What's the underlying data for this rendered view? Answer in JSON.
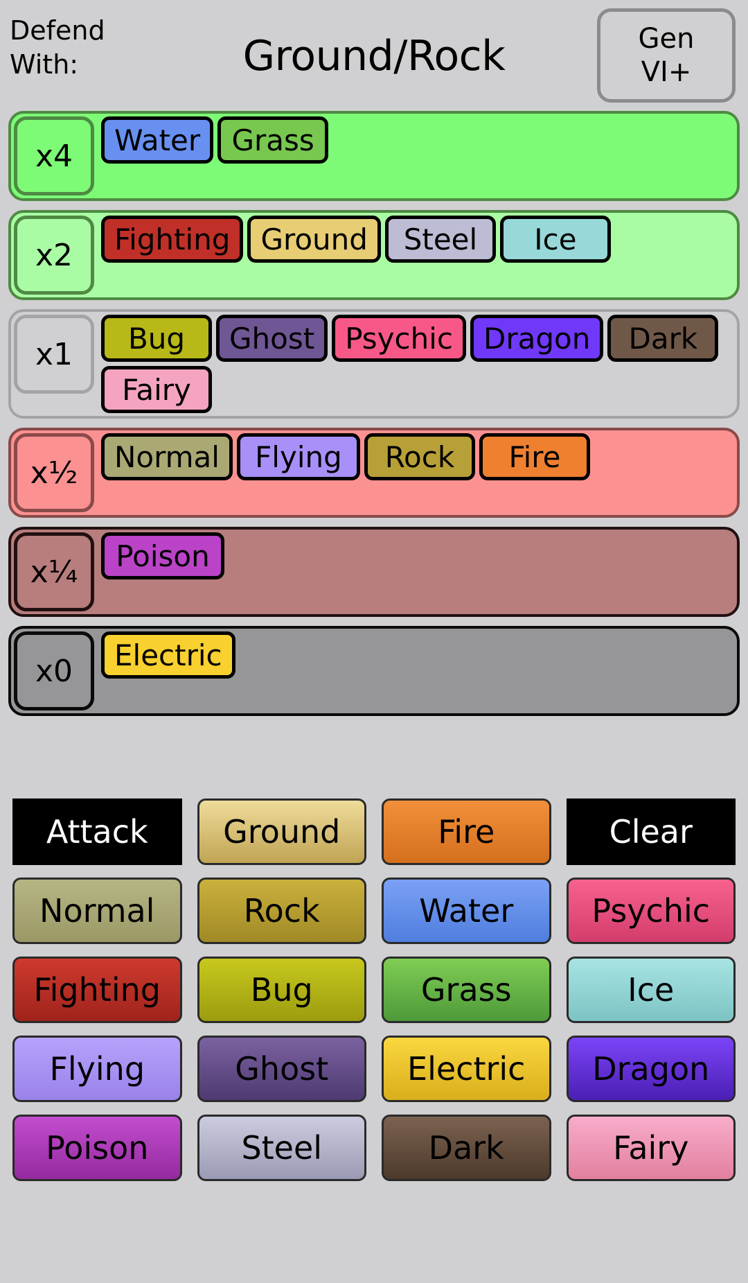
{
  "header": {
    "defend_line1": "Defend",
    "defend_line2": "With:",
    "title": "Ground/Rock",
    "gen_line1": "Gen",
    "gen_line2": "VI+"
  },
  "effectiveness": {
    "rows": [
      {
        "multiplier": "x4",
        "row_bg": "#7dfb76",
        "row_border": "#4e8a43",
        "label_bg": "#7dfb76",
        "label_border": "#4e8a43",
        "types": [
          {
            "name": "Water",
            "color": "#6890f0"
          },
          {
            "name": "Grass",
            "color": "#78c850"
          }
        ]
      },
      {
        "multiplier": "x2",
        "row_bg": "#aafca4",
        "row_border": "#4e8a43",
        "label_bg": "#aafca4",
        "label_border": "#4e8a43",
        "types": [
          {
            "name": "Fighting",
            "color": "#c03028"
          },
          {
            "name": "Ground",
            "color": "#e7cd74"
          },
          {
            "name": "Steel",
            "color": "#bcbcd4"
          },
          {
            "name": "Ice",
            "color": "#98d8d8"
          }
        ]
      },
      {
        "multiplier": "x1",
        "row_bg": "#d0d0d2",
        "row_border": "#a4a4a6",
        "label_bg": "#d0d0d2",
        "label_border": "#a4a4a6",
        "types": [
          {
            "name": "Bug",
            "color": "#b8b818"
          },
          {
            "name": "Ghost",
            "color": "#6f5694"
          },
          {
            "name": "Psychic",
            "color": "#f85888"
          },
          {
            "name": "Dragon",
            "color": "#7038f8"
          },
          {
            "name": "Dark",
            "color": "#705848"
          },
          {
            "name": "Fairy",
            "color": "#f4a4c0"
          }
        ]
      },
      {
        "multiplier": "x½",
        "row_bg": "#fb9191",
        "row_border": "#8a4a4a",
        "label_bg": "#fb9191",
        "label_border": "#8a4a4a",
        "types": [
          {
            "name": "Normal",
            "color": "#aaa974"
          },
          {
            "name": "Flying",
            "color": "#a890f8"
          },
          {
            "name": "Rock",
            "color": "#b8a038"
          },
          {
            "name": "Fire",
            "color": "#ef8030"
          }
        ]
      },
      {
        "multiplier": "x¼",
        "row_bg": "#b87d7d",
        "row_border": "#221010",
        "label_bg": "#b87d7d",
        "label_border": "#221010",
        "types": [
          {
            "name": "Poison",
            "color": "#ba43c7"
          }
        ]
      },
      {
        "multiplier": "x0",
        "row_bg": "#969698",
        "row_border": "#0a0a0a",
        "label_bg": "#969698",
        "label_border": "#0a0a0a",
        "types": [
          {
            "name": "Electric",
            "color": "#f8d030"
          }
        ]
      }
    ]
  },
  "buttons": {
    "items": [
      {
        "label": "Attack",
        "style": "plain",
        "top": "#000000",
        "bottom": "#000000",
        "text": "#ffffff"
      },
      {
        "label": "Ground",
        "style": "type",
        "top": "#efdc9a",
        "bottom": "#c0a454",
        "text": "#000000"
      },
      {
        "label": "Fire",
        "style": "type",
        "top": "#f2903a",
        "bottom": "#d46f1e",
        "text": "#000000"
      },
      {
        "label": "Clear",
        "style": "plain",
        "top": "#000000",
        "bottom": "#000000",
        "text": "#ffffff"
      },
      {
        "label": "Normal",
        "style": "type",
        "top": "#b6b584",
        "bottom": "#9a9966",
        "text": "#000000"
      },
      {
        "label": "Rock",
        "style": "type",
        "top": "#cbb03c",
        "bottom": "#a08a26",
        "text": "#000000"
      },
      {
        "label": "Water",
        "style": "type",
        "top": "#7ba1f5",
        "bottom": "#4f7ede",
        "text": "#000000"
      },
      {
        "label": "Psychic",
        "style": "type",
        "top": "#f8628f",
        "bottom": "#d23d6b",
        "text": "#000000"
      },
      {
        "label": "Fighting",
        "style": "type",
        "top": "#cf3a2e",
        "bottom": "#9f231c",
        "text": "#000000"
      },
      {
        "label": "Bug",
        "style": "type",
        "top": "#c8c81e",
        "bottom": "#9c9c10",
        "text": "#000000"
      },
      {
        "label": "Grass",
        "style": "type",
        "top": "#7fcd54",
        "bottom": "#4e9a3a",
        "text": "#000000"
      },
      {
        "label": "Ice",
        "style": "type",
        "top": "#a8e3e3",
        "bottom": "#7dc4c4",
        "text": "#000000"
      },
      {
        "label": "Flying",
        "style": "type",
        "top": "#b6a2fb",
        "bottom": "#9a82ea",
        "text": "#000000"
      },
      {
        "label": "Ghost",
        "style": "type",
        "top": "#7a62a0",
        "bottom": "#4f3a72",
        "text": "#000000"
      },
      {
        "label": "Electric",
        "style": "type",
        "top": "#fad73f",
        "bottom": "#d9ae1c",
        "text": "#000000"
      },
      {
        "label": "Dragon",
        "style": "type",
        "top": "#7b44f8",
        "bottom": "#4b1fb4",
        "text": "#000000"
      },
      {
        "label": "Poison",
        "style": "type",
        "top": "#c24dcf",
        "bottom": "#952a9f",
        "text": "#000000"
      },
      {
        "label": "Steel",
        "style": "type",
        "top": "#ccccdf",
        "bottom": "#9a9ab4",
        "text": "#000000"
      },
      {
        "label": "Dark",
        "style": "type",
        "top": "#7c6250",
        "bottom": "#4c3a2c",
        "text": "#000000"
      },
      {
        "label": "Fairy",
        "style": "type",
        "top": "#f8accb",
        "bottom": "#e2809f",
        "text": "#000000"
      }
    ]
  }
}
